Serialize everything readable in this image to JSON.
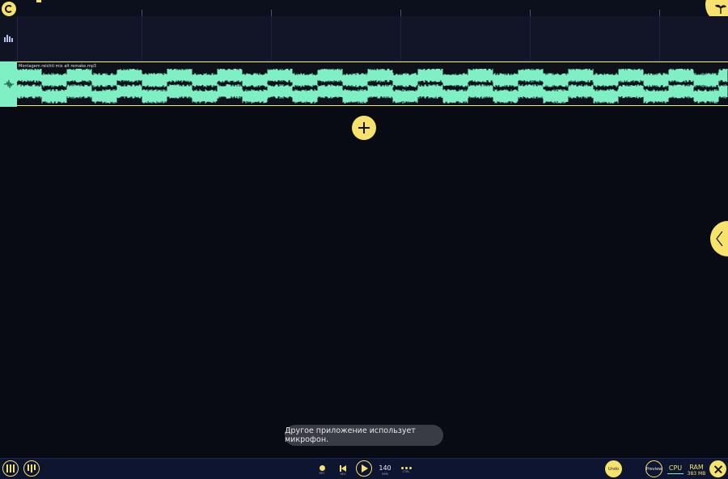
{
  "track": {
    "clip_name": "Montagem reichti mix alt remake.mp3",
    "waveform_color": "#7ef0c4",
    "selection_color": "#f7e26b"
  },
  "icons": {
    "logo": "logo-icon",
    "corner": "plant-icon",
    "lane1": "drum-pattern-icon",
    "lane2": "waveform-icon",
    "add": "plus-icon",
    "side": "chevron-left-icon"
  },
  "toast": "Другое приложение использует микрофон.",
  "transport": {
    "rec_label": "REC",
    "rew_label": "REV",
    "bpm_value": "140",
    "bpm_label": "BPM",
    "ctrl_label": "CTRL"
  },
  "right_controls": {
    "undo": "Undo",
    "preview": "Preview",
    "cpu": "CPU",
    "ram": "RAM",
    "ram_value": "383 MB"
  },
  "colors": {
    "accent": "#f7e26b",
    "background": "#090b14",
    "bottom_bar": "#0e1530"
  }
}
